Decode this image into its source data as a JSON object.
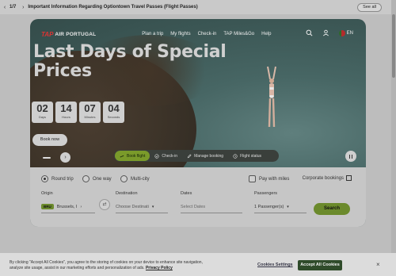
{
  "notice": {
    "prev_icon": "chevron-left-icon",
    "counter": "1/7",
    "next_icon": "chevron-right-icon",
    "message": "Important Information Regarding Optiontown Travel Passes (Flight Passes)",
    "see_all": "See all"
  },
  "nav": {
    "logo_tap": "TAP",
    "logo_air": "AIR PORTUGAL",
    "menu": [
      "Plan a trip",
      "My flights",
      "Check-in",
      "TAP Miles&Go",
      "Help"
    ],
    "lang": "EN"
  },
  "hero": {
    "headline": "Last Days of Special Prices",
    "countdown": [
      {
        "value": "02",
        "label": "Days"
      },
      {
        "value": "14",
        "label": "Hours"
      },
      {
        "value": "07",
        "label": "Minutes"
      },
      {
        "value": "04",
        "label": "Seconds"
      }
    ],
    "book_now": "Book now"
  },
  "tabs": [
    "Book flight",
    "Check-in",
    "Manage booking",
    "Flight status"
  ],
  "search": {
    "trip_types": [
      "Round trip",
      "One way",
      "Multi-city"
    ],
    "selected_trip": "Round trip",
    "pay_with_miles": "Pay with miles",
    "corporate": "Corporate bookings",
    "origin_label": "Origin",
    "origin_code": "BRU",
    "origin_value": "Brussels, I",
    "destination_label": "Destination",
    "destination_placeholder": "Choose Destinati",
    "dates_label": "Dates",
    "dates_placeholder": "Select Dates",
    "passengers_label": "Passengers",
    "passengers_value": "1 Passenger(s)",
    "search_button": "Search"
  },
  "cookie": {
    "text_line1": "By clicking \"Accept All Cookies\", you agree to the storing of cookies on your device to enhance site navigation,",
    "text_line2": "analyze site usage, assist in our marketing efforts and personalization of ads.",
    "privacy_link": "Privacy Policy",
    "settings": "Cookies Settings",
    "accept": "Accept All Cookies",
    "close_icon": "close-icon"
  },
  "colors": {
    "accent_green": "#6b8a2c",
    "accept_button": "#2f4b2a",
    "tap_red": "#dd3333"
  }
}
